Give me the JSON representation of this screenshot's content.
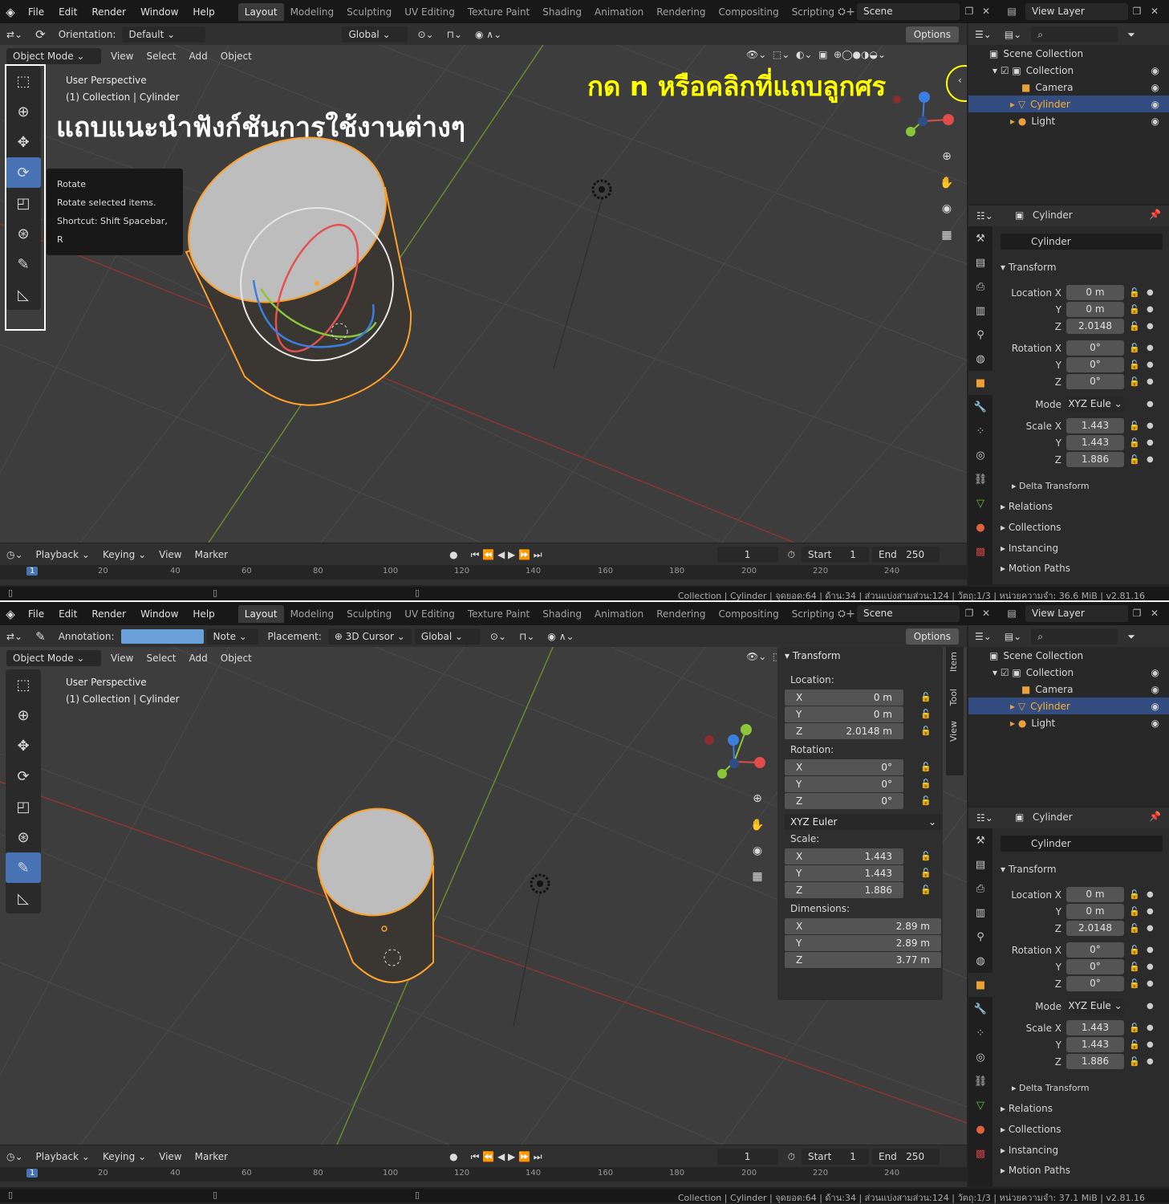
{
  "menus": [
    "File",
    "Edit",
    "Render",
    "Window",
    "Help"
  ],
  "workspaces": [
    "Layout",
    "Modeling",
    "Sculpting",
    "UV Editing",
    "Texture Paint",
    "Shading",
    "Animation",
    "Rendering",
    "Compositing",
    "Scripting"
  ],
  "scene_name": "Scene",
  "view_layer": "View Layer",
  "view3d_menus": [
    "Object Mode",
    "View",
    "Select",
    "Add",
    "Object"
  ],
  "options_label": "Options",
  "viewport_overlay": {
    "line1": "User Perspective",
    "line2": "(1) Collection | Cylinder"
  },
  "outliner": {
    "root": "Scene Collection",
    "items": [
      "Collection",
      "Camera",
      "Cylinder",
      "Light"
    ]
  },
  "properties": {
    "object_name": "Cylinder",
    "data_name": "Cylinder",
    "transform_label": "Transform",
    "location": {
      "label_x": "Location X",
      "x": "0 m",
      "y": "0 m",
      "z": "2.0148"
    },
    "rotation": {
      "label_x": "Rotation X",
      "x": "0°",
      "y": "0°",
      "z": "0°"
    },
    "mode": {
      "label": "Mode",
      "value": "XYZ Eule"
    },
    "scale": {
      "label_x": "Scale X",
      "x": "1.443",
      "y": "1.443",
      "z": "1.886"
    },
    "axis_y": "Y",
    "axis_z": "Z",
    "sections": [
      "Delta Transform",
      "Relations",
      "Collections",
      "Instancing",
      "Motion Paths"
    ]
  },
  "timeline": {
    "menus": [
      "Playback",
      "Keying",
      "View",
      "Marker"
    ],
    "frame": "1",
    "start_label": "Start",
    "start": "1",
    "end_label": "End",
    "end": "250",
    "ruler": [
      "1",
      "20",
      "40",
      "60",
      "80",
      "100",
      "120",
      "140",
      "160",
      "180",
      "200",
      "220",
      "240"
    ]
  },
  "status": {
    "top": "Collection | Cylinder | จุดยอด:64 | ด้าน:34 | ส่วนแบ่งสามส่วน:124 | วัตถุ:1/3 | หน่วยความจำ: 36.6 MiB | v2.81.16",
    "bottom": "Collection | Cylinder | จุดยอด:64 | ด้าน:34 | ส่วนแบ่งสามส่วน:124 | วัตถุ:1/3 | หน่วยความจำ: 37.1 MiB | v2.81.16"
  },
  "top_panel": {
    "orientation_label": "Orientation:",
    "orientation_value": "Default",
    "transform_space": "Global",
    "tooltip": {
      "title": "Rotate",
      "desc": "Rotate selected items.",
      "shortcut": "Shortcut: Shift Spacebar, R"
    },
    "annotation_toolbar": "แถบแนะนำฟังก์ชันการใช้งานต่างๆ",
    "annotation_npanel": "กด n หรือคลิกที่แถบลูกศร",
    "annotation_color": "#ffff00"
  },
  "bottom_panel": {
    "annotation_label": "Annotation:",
    "note_label": "Note",
    "placement_label": "Placement:",
    "placement_value": "3D Cursor",
    "transform_space": "Global",
    "sidebar_tabs": [
      "Item",
      "Tool",
      "View"
    ],
    "npanel": {
      "title": "Transform",
      "location_label": "Location:",
      "location": [
        "0 m",
        "0 m",
        "2.0148 m"
      ],
      "rotation_label": "Rotation:",
      "rotation": [
        "0°",
        "0°",
        "0°"
      ],
      "rotation_mode": "XYZ Euler",
      "scale_label": "Scale:",
      "scale": [
        "1.443",
        "1.443",
        "1.886"
      ],
      "dimensions_label": "Dimensions:",
      "dimensions": [
        "2.89 m",
        "2.89 m",
        "3.77 m"
      ],
      "axes": [
        "X",
        "Y",
        "Z"
      ]
    }
  },
  "colors": {
    "accent": "#4772b3",
    "selected_outline": "#ffa028",
    "axis_x": "#e24040",
    "axis_y": "#8cb83c",
    "axis_z": "#3a7fe0"
  }
}
